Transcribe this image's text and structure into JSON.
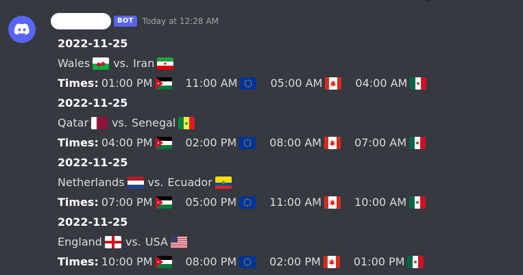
{
  "message": {
    "bot_tag": "BOT",
    "timestamp": "Today at 12:28 AM",
    "times_label": "Times:"
  },
  "matches": [
    {
      "date": "2022-11-25",
      "team1": "Wales",
      "team1_flag": "wales-flag",
      "vs": "vs.",
      "team2": "Iran",
      "team2_flag": "iran-flag",
      "times": [
        {
          "time": "01:00 PM",
          "flag": "jordan-flag"
        },
        {
          "time": "11:00 AM",
          "flag": "eu-flag"
        },
        {
          "time": "05:00 AM",
          "flag": "canada-flag"
        },
        {
          "time": "04:00 AM",
          "flag": "mexico-flag"
        }
      ]
    },
    {
      "date": "2022-11-25",
      "team1": "Qatar",
      "team1_flag": "qatar-flag",
      "vs": "vs.",
      "team2": "Senegal",
      "team2_flag": "senegal-flag",
      "times": [
        {
          "time": "04:00 PM",
          "flag": "jordan-flag"
        },
        {
          "time": "02:00 PM",
          "flag": "eu-flag"
        },
        {
          "time": "08:00 AM",
          "flag": "canada-flag"
        },
        {
          "time": "07:00 AM",
          "flag": "mexico-flag"
        }
      ]
    },
    {
      "date": "2022-11-25",
      "team1": "Netherlands",
      "team1_flag": "netherlands-flag",
      "vs": "vs.",
      "team2": "Ecuador",
      "team2_flag": "ecuador-flag",
      "times": [
        {
          "time": "07:00 PM",
          "flag": "jordan-flag"
        },
        {
          "time": "05:00 PM",
          "flag": "eu-flag"
        },
        {
          "time": "11:00 AM",
          "flag": "canada-flag"
        },
        {
          "time": "10:00 AM",
          "flag": "mexico-flag"
        }
      ]
    },
    {
      "date": "2022-11-25",
      "team1": "England",
      "team1_flag": "england-flag",
      "vs": "vs.",
      "team2": "USA",
      "team2_flag": "usa-flag",
      "times": [
        {
          "time": "10:00 PM",
          "flag": "jordan-flag"
        },
        {
          "time": "08:00 PM",
          "flag": "eu-flag"
        },
        {
          "time": "02:00 PM",
          "flag": "canada-flag"
        },
        {
          "time": "01:00 PM",
          "flag": "mexico-flag"
        }
      ]
    }
  ],
  "colors": {
    "background": "#36393f",
    "blurple": "#5865f2",
    "text": "#dcddde",
    "timestamp": "#a3a6aa"
  }
}
